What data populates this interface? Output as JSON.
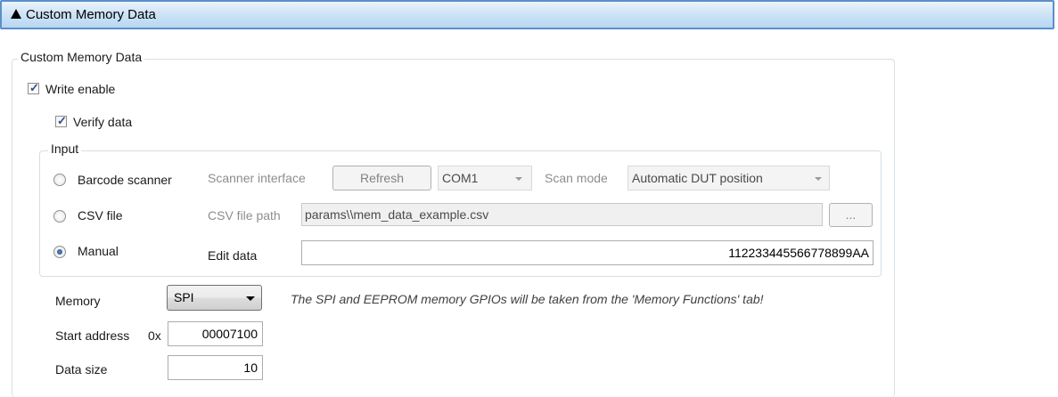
{
  "header": {
    "title": "Custom Memory Data"
  },
  "group": {
    "title": "Custom Memory Data"
  },
  "write_enable": {
    "label": "Write enable",
    "checked": true
  },
  "verify_data": {
    "label": "Verify data",
    "checked": true
  },
  "input_group": {
    "title": "Input",
    "barcode": {
      "label": "Barcode scanner",
      "scanner_interface_label": "Scanner interface",
      "refresh_label": "Refresh",
      "port_value": "COM1",
      "scan_mode_label": "Scan mode",
      "scan_mode_value": "Automatic DUT position"
    },
    "csv": {
      "label": "CSV file",
      "path_label": "CSV file path",
      "path_value": "params\\\\mem_data_example.csv",
      "browse_label": "..."
    },
    "manual": {
      "label": "Manual",
      "selected": true,
      "edit_label": "Edit data",
      "edit_value": "112233445566778899AA"
    }
  },
  "memory": {
    "label": "Memory",
    "value": "SPI",
    "note": "The SPI and EEPROM memory GPIOs will be taken from the 'Memory Functions' tab!"
  },
  "start_address": {
    "label": "Start address",
    "prefix": "0x",
    "value": "00007100"
  },
  "data_size": {
    "label": "Data size",
    "value": "10"
  }
}
